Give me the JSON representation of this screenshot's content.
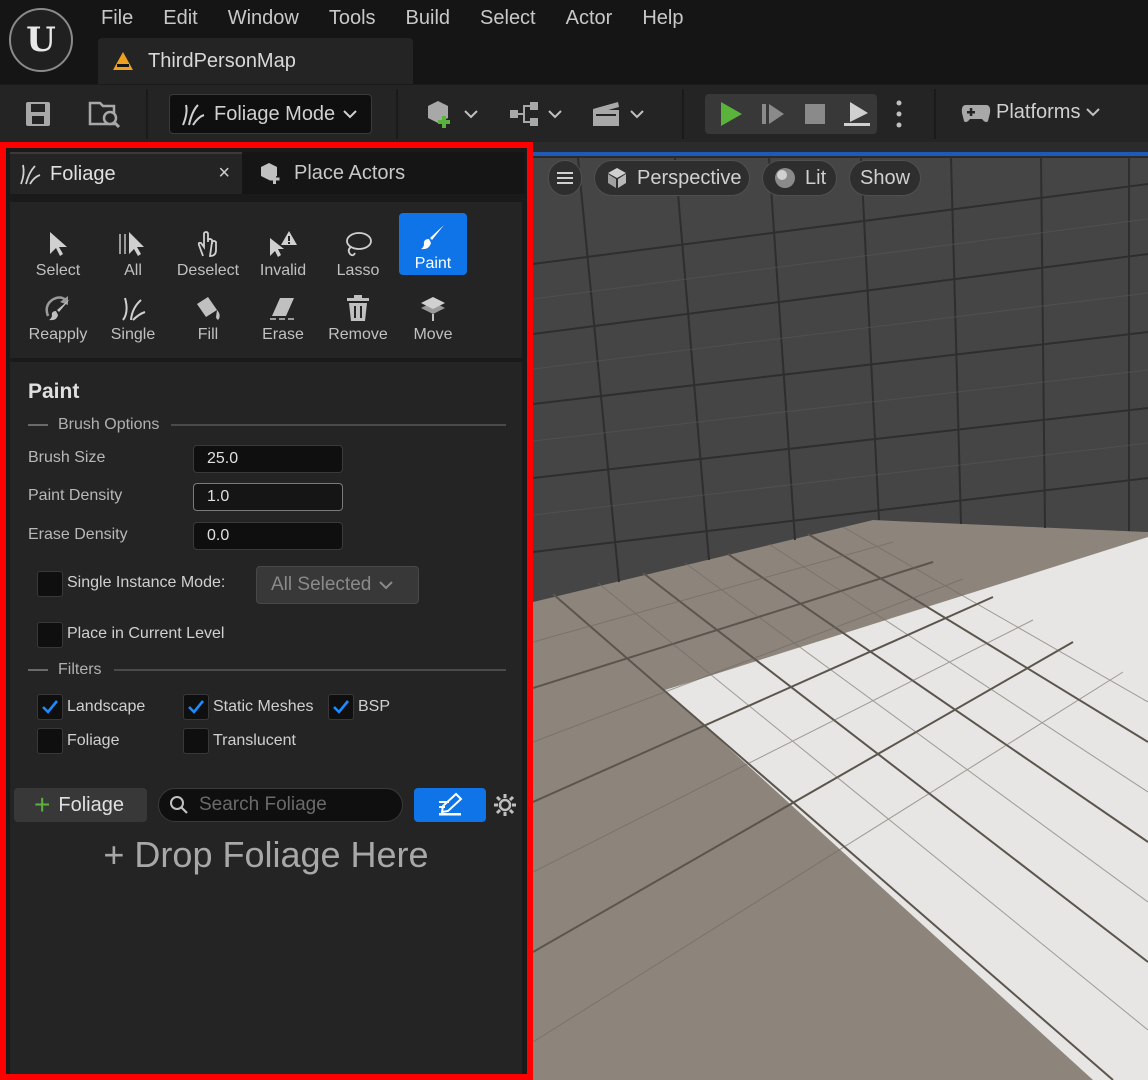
{
  "app": {
    "menu": [
      "File",
      "Edit",
      "Window",
      "Tools",
      "Build",
      "Select",
      "Actor",
      "Help"
    ],
    "level_tab": "ThirdPersonMap"
  },
  "toolbar": {
    "mode_label": "Foliage Mode",
    "platforms_label": "Platforms"
  },
  "panel": {
    "tabs": {
      "foliage": "Foliage",
      "close": "×",
      "place_actors": "Place Actors"
    },
    "tools": [
      {
        "label": "Select",
        "icon": "arrow-cursor-icon",
        "active": false
      },
      {
        "label": "All",
        "icon": "select-all-icon",
        "active": false
      },
      {
        "label": "Deselect",
        "icon": "deselect-hand-icon",
        "active": false
      },
      {
        "label": "Invalid",
        "icon": "invalid-warning-icon",
        "active": false
      },
      {
        "label": "Lasso",
        "icon": "lasso-icon",
        "active": false
      },
      {
        "label": "Paint",
        "icon": "paintbrush-icon",
        "active": true
      },
      {
        "label": "Reapply",
        "icon": "reapply-icon",
        "active": false
      },
      {
        "label": "Single",
        "icon": "single-grass-icon",
        "active": false
      },
      {
        "label": "Fill",
        "icon": "fill-bucket-icon",
        "active": false
      },
      {
        "label": "Erase",
        "icon": "eraser-icon",
        "active": false
      },
      {
        "label": "Remove",
        "icon": "trash-icon",
        "active": false
      },
      {
        "label": "Move",
        "icon": "move-layers-icon",
        "active": false
      }
    ],
    "paint": {
      "title": "Paint",
      "brush_options_header": "Brush Options",
      "brush_size_label": "Brush Size",
      "brush_size_value": "25.0",
      "paint_density_label": "Paint Density",
      "paint_density_value": "1.0",
      "erase_density_label": "Erase Density",
      "erase_density_value": "0.0",
      "single_instance_label": "Single Instance Mode:",
      "single_instance_checked": false,
      "single_instance_dropdown": "All Selected",
      "place_current_level_label": "Place in Current Level",
      "place_current_level_checked": false,
      "filters_header": "Filters",
      "filters": {
        "landscape": {
          "label": "Landscape",
          "checked": true
        },
        "static_meshes": {
          "label": "Static Meshes",
          "checked": true
        },
        "bsp": {
          "label": "BSP",
          "checked": true
        },
        "foliage": {
          "label": "Foliage",
          "checked": false
        },
        "translucent": {
          "label": "Translucent",
          "checked": false
        }
      }
    },
    "bottom": {
      "add_button": "Foliage",
      "search_placeholder": "Search Foliage",
      "drop_hint": "+ Drop Foliage Here"
    }
  },
  "viewport": {
    "perspective_label": "Perspective",
    "lit_label": "Lit",
    "show_label": "Show"
  },
  "colors": {
    "accent_blue": "#0e74e8",
    "highlight_border": "#ff0000",
    "play_green": "#5ab33a"
  }
}
